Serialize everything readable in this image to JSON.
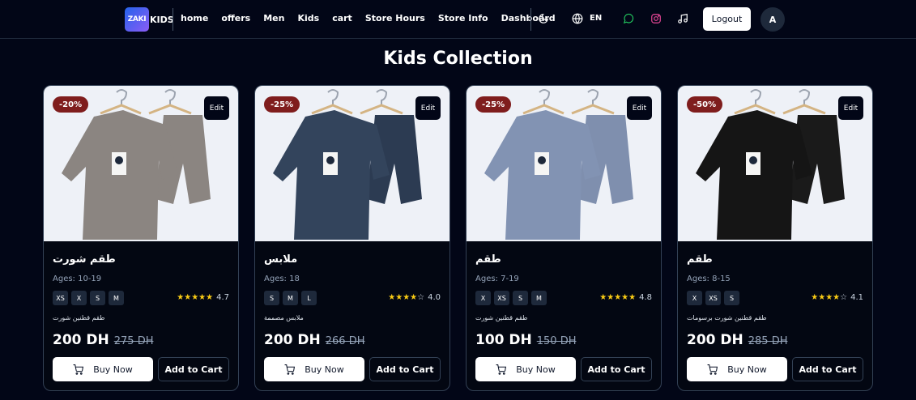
{
  "nav": {
    "logo_mark": "ZAKI",
    "logo_text": "KIDS",
    "links": [
      "home",
      "offers",
      "Men",
      "Kids",
      "cart",
      "Store Hours",
      "Store Info",
      "Dashboard"
    ],
    "language": "EN",
    "logout_label": "Logout",
    "avatar_letter": "A",
    "icons": [
      "moon-icon",
      "globe-icon",
      "whatsapp-icon",
      "instagram-icon",
      "tiktok-icon"
    ]
  },
  "page": {
    "title": "Kids Collection"
  },
  "colors": {
    "background": "#020617",
    "discount_badge": "#7f1d1d",
    "star": "#facc15"
  },
  "products": [
    {
      "discount": "-20%",
      "edit_label": "Edit",
      "name": "طقم شورت",
      "ages": "Ages: 10-19",
      "sizes": [
        "XS",
        "X",
        "S",
        "M"
      ],
      "rating": "4.7",
      "stars": 5,
      "description": "طقم قطنين شورت",
      "price": "200 DH",
      "old_price": "275 DH",
      "buy_label": "Buy Now",
      "cart_label": "Add to Cart",
      "image": {
        "shirt": "#8b8581",
        "shorts": "#8b8581"
      }
    },
    {
      "discount": "-25%",
      "edit_label": "Edit",
      "name": "ملابس",
      "ages": "Ages: 18",
      "sizes": [
        "S",
        "M",
        "L"
      ],
      "rating": "4.0",
      "stars": 4,
      "description": "ملابس مصممة",
      "price": "200 DH",
      "old_price": "266 DH",
      "buy_label": "Buy Now",
      "cart_label": "Add to Cart",
      "image": {
        "shirt": "#33445c",
        "shorts": "#2c3b52"
      }
    },
    {
      "discount": "-25%",
      "edit_label": "Edit",
      "name": "طقم",
      "ages": "Ages: 7-19",
      "sizes": [
        "X",
        "XS",
        "S",
        "M"
      ],
      "rating": "4.8",
      "stars": 5,
      "description": "طقم قطنين شورت",
      "price": "100 DH",
      "old_price": "150 DH",
      "buy_label": "Buy Now",
      "cart_label": "Add to Cart",
      "image": {
        "shirt": "#8293b3",
        "shorts": "#7f8fae"
      }
    },
    {
      "discount": "-50%",
      "edit_label": "Edit",
      "name": "طقم",
      "ages": "Ages: 8-15",
      "sizes": [
        "X",
        "XS",
        "S"
      ],
      "rating": "4.1",
      "stars": 4,
      "description": "طقم قطنين شورت برسومات",
      "price": "200 DH",
      "old_price": "285 DH",
      "buy_label": "Buy Now",
      "cart_label": "Add to Cart",
      "image": {
        "shirt": "#151515",
        "shorts": "#1a1a1a"
      }
    }
  ]
}
